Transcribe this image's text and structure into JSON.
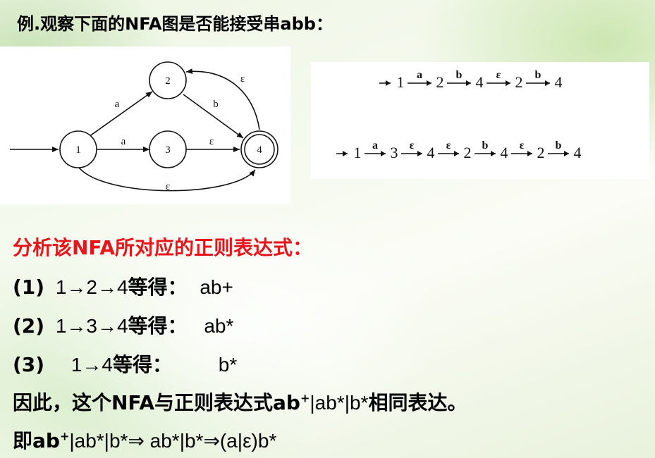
{
  "title": "例.观察下面的NFA图是否能接受串abb：",
  "nfa": {
    "states": [
      "1",
      "2",
      "3",
      "4"
    ],
    "edges": [
      {
        "from": "1",
        "to": "2",
        "label": "a"
      },
      {
        "from": "1",
        "to": "3",
        "label": "a"
      },
      {
        "from": "2",
        "to": "4",
        "label": "b"
      },
      {
        "from": "3",
        "to": "4",
        "label": "ε"
      },
      {
        "from": "4",
        "to": "2",
        "label": "ε"
      },
      {
        "from": "1",
        "to": "4",
        "label": "ε"
      }
    ]
  },
  "paths": [
    {
      "start": "1",
      "steps": [
        {
          "sym": "a",
          "to": "2"
        },
        {
          "sym": "b",
          "to": "4"
        },
        {
          "sym": "ε",
          "to": "2"
        },
        {
          "sym": "b",
          "to": "4"
        }
      ]
    },
    {
      "start": "1",
      "steps": [
        {
          "sym": "a",
          "to": "3"
        },
        {
          "sym": "ε",
          "to": "4"
        },
        {
          "sym": "ε",
          "to": "2"
        },
        {
          "sym": "b",
          "to": "4"
        },
        {
          "sym": "ε",
          "to": "2"
        },
        {
          "sym": "b",
          "to": "4"
        }
      ]
    }
  ],
  "analysis_heading": "分析该NFA所对应的正则表达式：",
  "cases": [
    {
      "label": "(1)",
      "path": "1→2→4",
      "suffix": "等得：",
      "result": "ab+"
    },
    {
      "label": "(2)",
      "path": "1→3→4",
      "suffix": "等得：",
      "result": "ab*"
    },
    {
      "label": "(3)",
      "path": "1→4",
      "suffix": "等得：",
      "result": "b*"
    }
  ],
  "conclusion_prefix": "因此，这个NFA与正则表达式ab",
  "conclusion_expr": "|ab*|b*",
  "conclusion_suffix": "相同表达。",
  "derivation_prefix": "即ab",
  "derivation_rest": "|ab*|b*⇒ ab*|b*⇒(a|ε)b*",
  "sup_plus": "+"
}
